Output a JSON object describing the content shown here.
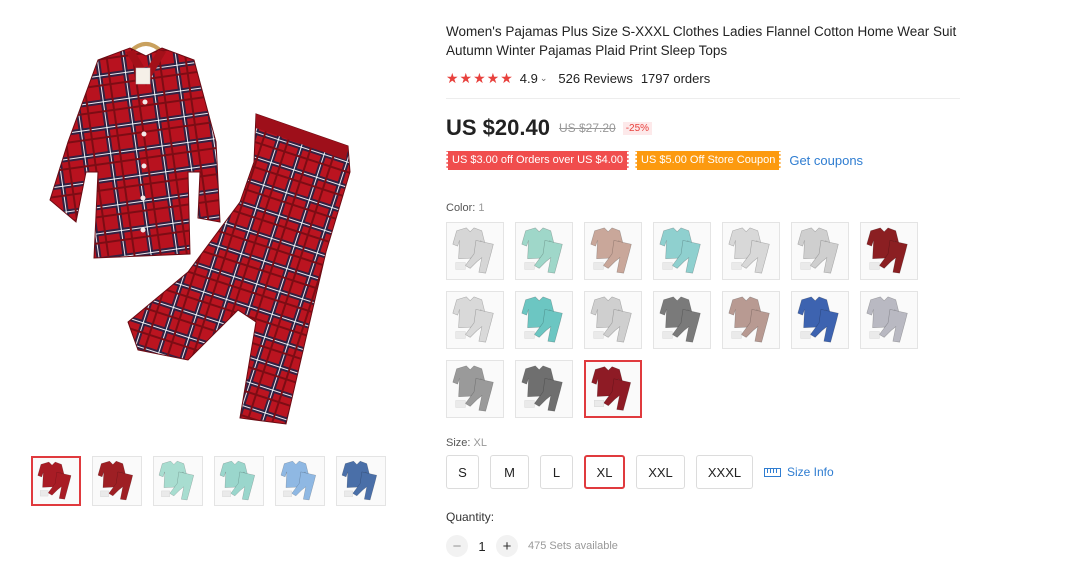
{
  "product": {
    "title": "Women's Pajamas Plus Size S-XXXL Clothes Ladies Flannel Cotton Home Wear Suit Autumn Winter Pajamas Plaid Print Sleep Tops",
    "stars": "★★★★★",
    "rating": "4.9",
    "reviews": "526 Reviews",
    "orders": "1797 orders"
  },
  "price": {
    "current": "US $20.40",
    "original": "US $27.20",
    "discount": "-25%"
  },
  "coupons": {
    "coupon1": "US $3.00 off Orders over US $4.00",
    "coupon2": "US $5.00 Off Store Coupon",
    "get_label": "Get coupons"
  },
  "color": {
    "label": "Color:",
    "value": "1",
    "swatch_colors": [
      "#d6d6d6",
      "#9fd7c9",
      "#c9a79a",
      "#8fd0cf",
      "#d8d8d8",
      "#cfcfcf",
      "#8b1f22",
      "#d9d9d9",
      "#6cc6c2",
      "#cfcfcf",
      "#7a7a7a",
      "#b89a92",
      "#3d63b0",
      "#b9b9c2",
      "#9a9a9a",
      "#6f6f6f",
      "#8e1b25"
    ],
    "selected_index": 16
  },
  "size": {
    "label": "Size:",
    "value": "XL",
    "options": [
      "S",
      "M",
      "L",
      "XL",
      "XXL",
      "XXXL"
    ],
    "selected": "XL",
    "info_label": "Size Info"
  },
  "quantity": {
    "label": "Quantity:",
    "minus": "−",
    "plus": "+",
    "value": "1",
    "available": "475 Sets available"
  },
  "gallery": {
    "thumb_colors": [
      "#a81c25",
      "#9e1f24",
      "#a8ddd0",
      "#9ad6cc",
      "#8fb8e3",
      "#4a6fa8"
    ],
    "active_index": 0
  },
  "theme": {
    "accent": "#e03a3e",
    "link": "#2f7dd1",
    "coupon_red": "#f04d4d",
    "coupon_orange": "#fc9a0f"
  }
}
